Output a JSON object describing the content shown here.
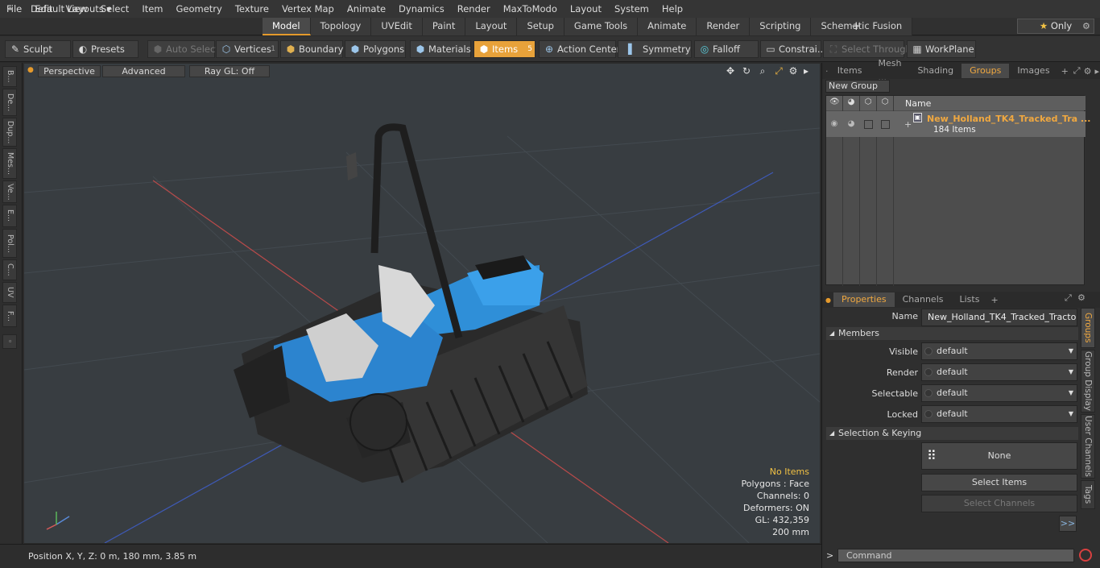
{
  "menu": [
    "File",
    "Edit",
    "View",
    "Select",
    "Item",
    "Geometry",
    "Texture",
    "Vertex Map",
    "Animate",
    "Dynamics",
    "Render",
    "MaxToModo",
    "Layout",
    "System",
    "Help"
  ],
  "layout_selector": "Default Layouts",
  "mode_tabs": [
    "Model",
    "Topology",
    "UVEdit",
    "Paint",
    "Layout",
    "Setup",
    "Game Tools",
    "Animate",
    "Render",
    "Scripting",
    "Schematic Fusion"
  ],
  "active_mode_tab": "Model",
  "only_label": "Only",
  "toolbar": {
    "sculpt": "Sculpt",
    "presets": "Presets",
    "auto_select": "Auto Select",
    "vertices": "Vertices",
    "vertices_count": "1",
    "boundary": "Boundary",
    "polygons": "Polygons",
    "materials": "Materials",
    "items": "Items",
    "items_count": "5",
    "action_center": "Action Center",
    "symmetry": "Symmetry",
    "falloff": "Falloff",
    "constraints": "Constrai...",
    "select_through": "Select Through",
    "workplane": "WorkPlane"
  },
  "left_tabs": [
    "B...",
    "De...",
    "Dup...",
    "Mes...",
    "Ve...",
    "E...",
    "Pol...",
    "C...",
    "UV",
    "F..."
  ],
  "viewport": {
    "projection": "Perspective",
    "mode": "Advanced",
    "raygl": "Ray GL: Off",
    "stats": {
      "selection": "No Items",
      "polygons": "Polygons : Face",
      "channels": "Channels: 0",
      "deformers": "Deformers: ON",
      "gl": "GL: 432,359",
      "scale": "200 mm"
    }
  },
  "status": {
    "position": "Position X, Y, Z:   0 m, 180 mm, 3.85 m"
  },
  "top_panel": {
    "tabs": [
      "Items",
      "Mesh ...",
      "Shading",
      "Groups",
      "Images"
    ],
    "active_tab": "Groups",
    "new_group": "New Group",
    "name_header": "Name",
    "group_name": "New_Holland_TK4_Tracked_Tra ...",
    "group_count": "184 Items"
  },
  "properties": {
    "tabs": [
      "Properties",
      "Channels",
      "Lists"
    ],
    "active_tab": "Properties",
    "name_label": "Name",
    "name_value": "New_Holland_TK4_Tracked_Tractor_N",
    "members_label": "Members",
    "visible_label": "Visible",
    "visible_value": "default",
    "render_label": "Render",
    "render_value": "default",
    "selectable_label": "Selectable",
    "selectable_value": "default",
    "locked_label": "Locked",
    "locked_value": "default",
    "sel_keying_label": "Selection & Keying",
    "none_button": "None",
    "select_items": "Select Items",
    "select_channels": "Select Channels",
    "more": ">>"
  },
  "side_tabs": [
    "Groups",
    "Group Display",
    "User Channels",
    "Tags"
  ],
  "command_placeholder": "Command"
}
